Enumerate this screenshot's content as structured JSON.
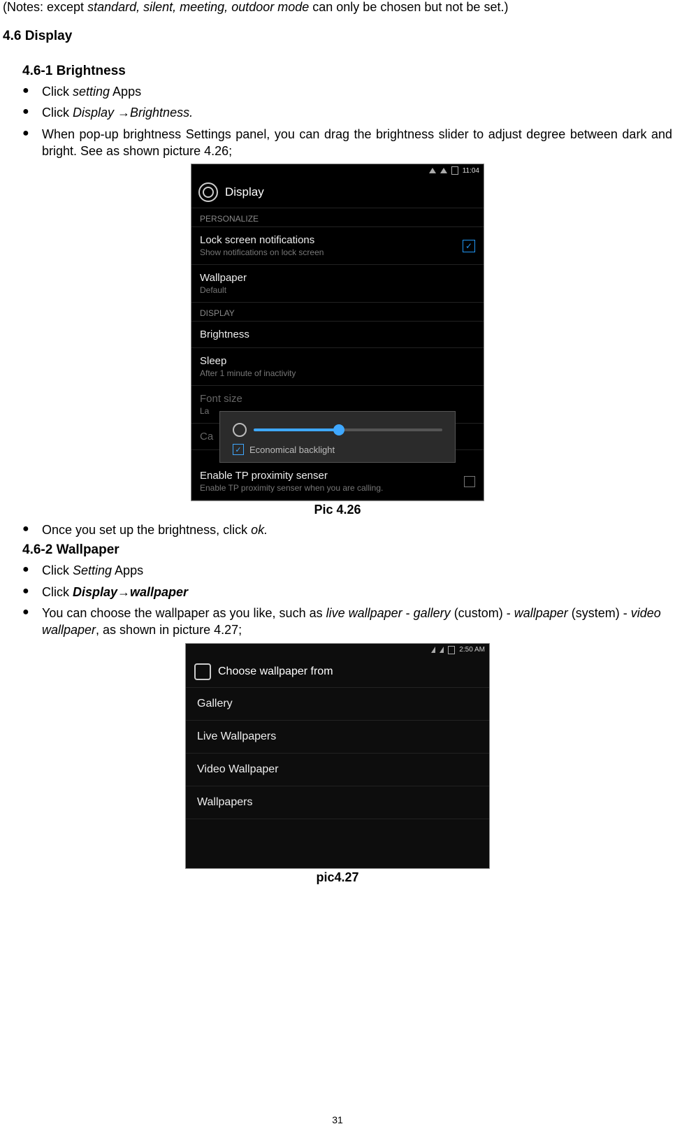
{
  "notes": {
    "prefix": "(Notes: except ",
    "modes": "standard",
    "modes_rest": ", silent, meeting, outdoor mode",
    "suffix": " can only be chosen but not be set.)"
  },
  "section_4_6": "4.6 Display",
  "section_4_6_1": "4.6-1 Brightness",
  "bullets1": {
    "b1_a": "Click   ",
    "b1_b": "setting",
    "b1_c": " Apps",
    "b2_a": "Click ",
    "b2_b": "Display ",
    "b2_arrow": "→",
    "b2_c": "Brightness.",
    "b3": "When pop-up brightness Settings panel, you can drag the brightness slider to adjust degree between dark and bright. See as shown picture 4.26;"
  },
  "scr1": {
    "time": "11:04",
    "title": "Display",
    "sec_personalize": "PERSONALIZE",
    "lock_title": "Lock screen notifications",
    "lock_sub": "Show notifications on lock screen",
    "wallpaper_title": "Wallpaper",
    "wallpaper_sub": "Default",
    "sec_display": "DISPLAY",
    "brightness": "Brightness",
    "sleep": "Sleep",
    "sleep_sub": "After 1 minute of inactivity",
    "font": "Font size",
    "font_sub": "La",
    "ca": "Ca",
    "eco": "Economical backlight",
    "tp_title": "Enable TP proximity senser",
    "tp_sub": "Enable TP proximity senser when you are calling."
  },
  "caption1": "Pic   4.26",
  "bullets_mid": {
    "b4_a": "Once you set up the brightness, click ",
    "b4_b": "ok."
  },
  "section_4_6_2": "4.6-2 Wallpaper",
  "bullets2": {
    "b1_a": "Click ",
    "b1_b": "Setting",
    "b1_c": " Apps",
    "b2_a": "Click ",
    "b2_b": "Display",
    "b2_arrow": "→",
    "b2_c": "wallpaper",
    "b3_a": "You can choose the wallpaper as you like, such as ",
    "b3_b": "live wallpaper",
    "b3_c": " - ",
    "b3_d": "gallery",
    "b3_e": " (custom) - ",
    "b3_f": "wallpaper",
    "b3_g": " (system) - ",
    "b3_h": "video wallpaper",
    "b3_i": ", as shown in picture 4.27;"
  },
  "scr2": {
    "time": "2:50 AM",
    "title": "Choose wallpaper from",
    "opt1": "Gallery",
    "opt2": "Live Wallpapers",
    "opt3": "Video Wallpaper",
    "opt4": "Wallpapers"
  },
  "caption2": "pic4.27",
  "page_number": "31"
}
